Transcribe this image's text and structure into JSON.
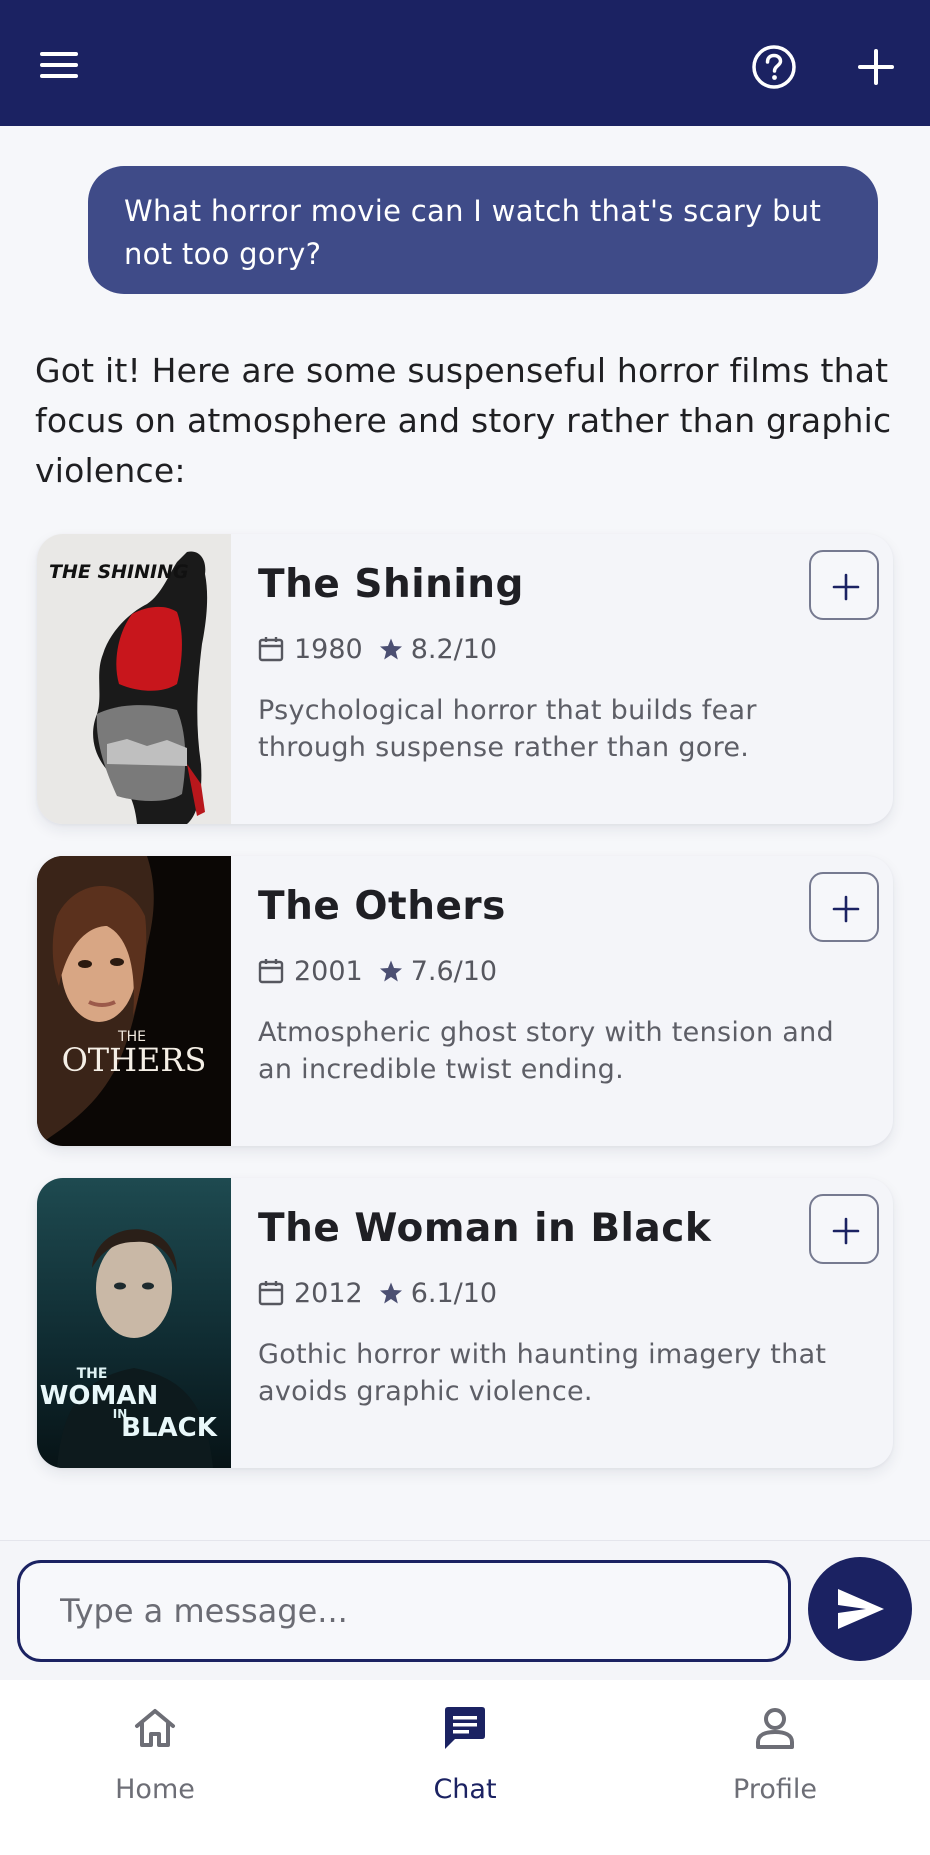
{
  "app": {
    "accent": "#1b2262",
    "user_bubble_color": "#3f4b88",
    "header_icons": [
      "menu-icon",
      "help-icon",
      "add-icon"
    ]
  },
  "chat": {
    "user_message": "What horror movie can I watch that's scary but not too gory?",
    "bot_message": "Got it! Here are some suspenseful horror films that focus on atmosphere and story rather than graphic violence:"
  },
  "movies": [
    {
      "title": "The Shining",
      "year": "1980",
      "rating": "8.2/10",
      "description": "Psychological horror that builds fear through suspense rather than gore.",
      "poster_text": "THE SHINING"
    },
    {
      "title": "The Others",
      "year": "2001",
      "rating": "7.6/10",
      "description": "Atmospheric ghost story with tension and an incredible twist ending.",
      "poster_text_small": "THE",
      "poster_text_large": "OTHERS"
    },
    {
      "title": "The Woman in Black",
      "year": "2012",
      "rating": "6.1/10",
      "description": "Gothic horror with haunting imagery that avoids graphic violence.",
      "poster_text_small": "THE",
      "poster_text_large": "WOMAN",
      "poster_text_in": "IN",
      "poster_text_black": "BLACK"
    }
  ],
  "composer": {
    "placeholder": "Type a message...",
    "send_icon": "send-icon"
  },
  "nav": {
    "items": [
      {
        "label": "Home",
        "icon": "home-icon",
        "active": false
      },
      {
        "label": "Chat",
        "icon": "chat-icon",
        "active": true
      },
      {
        "label": "Profile",
        "icon": "profile-icon",
        "active": false
      }
    ]
  }
}
